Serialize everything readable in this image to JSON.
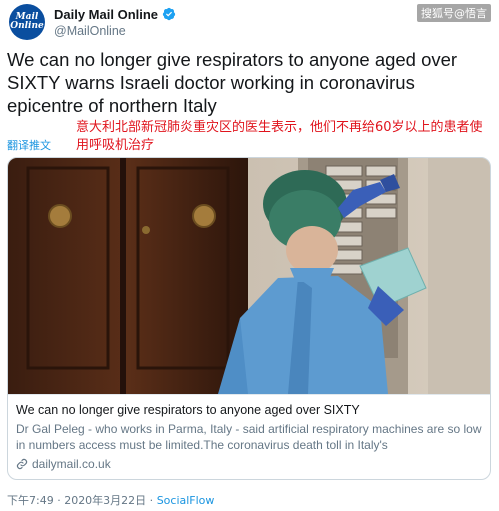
{
  "watermark": "搜狐号@悟言",
  "account": {
    "avatar_line1": "Mail",
    "avatar_line2": "Online",
    "display_name": "Daily Mail Online",
    "handle": "@MailOnline"
  },
  "tweet": {
    "text": "We can no longer give respirators to anyone aged over SIXTY warns Israeli doctor working in coronavirus epicentre of northern Italy",
    "translate_label": "翻译推文",
    "translation": "意大利北部新冠肺炎重灾区的医生表示，他们不再给60岁以上的患者使用呼吸机治疗"
  },
  "card": {
    "title": "We can no longer give respirators to anyone aged over SIXTY",
    "description": "Dr Gal Peleg - who works in Parma, Italy - said artificial respiratory machines are so low in numbers access must be limited.The coronavirus death toll in Italy's",
    "domain": "dailymail.co.uk"
  },
  "footer": {
    "timestamp": "下午7:49 · 2020年3月22日",
    "separator": " · ",
    "source": "SocialFlow"
  },
  "colors": {
    "link": "#1b95e0",
    "translation": "#e0141d",
    "brand": "#0a4e9f"
  }
}
